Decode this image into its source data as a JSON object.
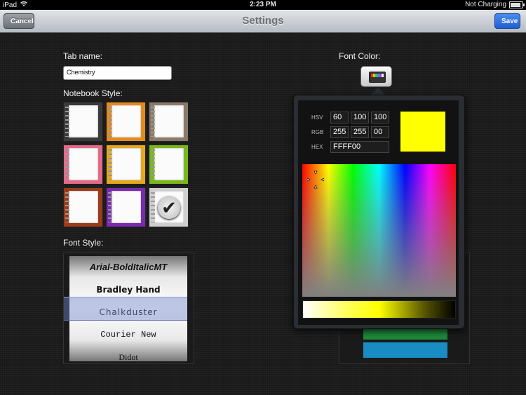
{
  "status": {
    "carrier": "iPad",
    "time": "2:23 PM",
    "battery": "Not Charging"
  },
  "nav": {
    "title": "Settings",
    "cancel": "Cancel",
    "save": "Save"
  },
  "tab": {
    "label": "Tab name:",
    "value": "Chemistry"
  },
  "notebook": {
    "label": "Notebook Style:",
    "styles": [
      {
        "color": "#3a3a3a",
        "selected": false
      },
      {
        "color": "#e58a1a",
        "selected": false
      },
      {
        "color": "#8a7a6a",
        "selected": false
      },
      {
        "color": "#e36a8a",
        "selected": false
      },
      {
        "color": "#e6a81a",
        "selected": false
      },
      {
        "color": "#7ab81a",
        "selected": false
      },
      {
        "color": "#9a3a1a",
        "selected": false
      },
      {
        "color": "#7a2ab0",
        "selected": false
      },
      {
        "color": "#cfcfcf",
        "selected": true
      }
    ]
  },
  "font_style": {
    "label": "Font Style:",
    "items": [
      "Arial-BoldItalicMT",
      "Bradley Hand",
      "Chalkduster",
      "Courier New",
      "Didot"
    ],
    "selected": "Chalkduster"
  },
  "font_color": {
    "label": "Font Color:"
  },
  "color_picker": {
    "hsv_label": "HSV",
    "rgb_label": "RGB",
    "hex_label": "HEX",
    "h": "60",
    "s": "100",
    "v": "100",
    "r": "255",
    "g": "255",
    "b": "00",
    "hex": "FFFF00",
    "current_color": "#FFFF00",
    "brightness_level": 0.47
  }
}
